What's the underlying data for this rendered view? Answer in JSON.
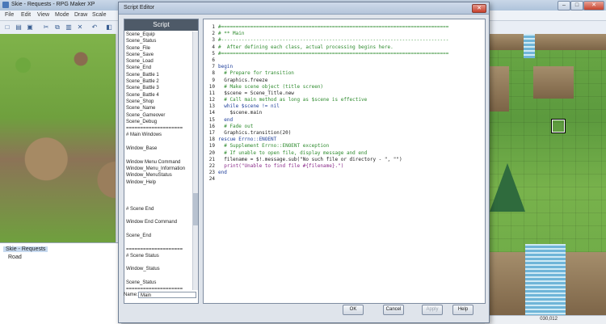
{
  "app": {
    "title": "Skie - Requests - RPG Maker XP",
    "window_buttons": [
      "–",
      "□",
      "✕"
    ]
  },
  "menu": [
    "File",
    "Edit",
    "View",
    "Mode",
    "Draw",
    "Scale"
  ],
  "map_tree": {
    "root": "Skie - Requests",
    "child": "Road"
  },
  "status": {
    "coords": "030,012"
  },
  "dialog": {
    "title": "Script Editor",
    "close": "✕",
    "list_header": "Script",
    "name_label": "Name:",
    "name_value": "Main",
    "buttons": {
      "ok": "OK",
      "cancel": "Cancel",
      "apply": "Apply",
      "help": "Help"
    }
  },
  "script_list": [
    "Scene_Equip",
    "Scene_Status",
    "Scene_File",
    "Scene_Save",
    "Scene_Load",
    "Scene_End",
    "Scene_Battle 1",
    "Scene_Battle 2",
    "Scene_Battle 3",
    "Scene_Battle 4",
    "Scene_Shop",
    "Scene_Name",
    "Scene_Gameover",
    "Scene_Debug",
    "====================",
    "# Main Windows",
    "",
    "Window_Base",
    "",
    "Window Menu Command",
    "Window_Menu_Information",
    "Window_MenuStatus",
    "Window_Help",
    "",
    "",
    "",
    "# Scene End",
    "",
    "Window End Command",
    "",
    "Scene_End",
    "",
    "====================",
    "# Scene Status",
    "",
    "Window_Status",
    "",
    "Scene_Status",
    "====================",
    "# Scene Menu",
    "",
    "Scene_Menu",
    "AMS",
    "Main"
  ],
  "selected_script": "Main",
  "code_lines": [
    {
      "n": "1",
      "text": "#==============================================================================",
      "style": "sep"
    },
    {
      "n": "2",
      "text": "# ** Main",
      "style": "comment"
    },
    {
      "n": "3",
      "text": "#------------------------------------------------------------------------------",
      "style": "sep"
    },
    {
      "n": "4",
      "text": "#  After defining each class, actual processing begins here.",
      "style": "comment"
    },
    {
      "n": "5",
      "text": "#==============================================================================",
      "style": "sep"
    },
    {
      "n": "6",
      "text": "",
      "style": "code"
    },
    {
      "n": "7",
      "text": "begin",
      "style": "keyword"
    },
    {
      "n": "8",
      "text": "  # Prepare for transition",
      "style": "comment"
    },
    {
      "n": "9",
      "text": "  Graphics.freeze",
      "style": "code"
    },
    {
      "n": "10",
      "text": "  # Make scene object (title screen)",
      "style": "comment"
    },
    {
      "n": "11",
      "text": "  $scene = Scene_Title.new",
      "style": "code"
    },
    {
      "n": "12",
      "text": "  # Call main method as long as $scene is effective",
      "style": "comment"
    },
    {
      "n": "13",
      "text": "  while $scene != nil",
      "style": "keyword"
    },
    {
      "n": "14",
      "text": "    $scene.main",
      "style": "code"
    },
    {
      "n": "15",
      "text": "  end",
      "style": "keyword"
    },
    {
      "n": "16",
      "text": "  # Fade out",
      "style": "comment"
    },
    {
      "n": "17",
      "text": "  Graphics.transition(20)",
      "style": "code"
    },
    {
      "n": "18",
      "text": "rescue Errno::ENOENT",
      "style": "keyword"
    },
    {
      "n": "19",
      "text": "  # Supplement Errno::ENOENT exception",
      "style": "comment"
    },
    {
      "n": "20",
      "text": "  # If unable to open file, display message and end",
      "style": "comment"
    },
    {
      "n": "21",
      "text": "  filename = $!.message.sub(\"No such file or directory - \", \"\")",
      "style": "code"
    },
    {
      "n": "22",
      "text": "  print(\"Unable to find file #{filename}.\")",
      "style": "string"
    },
    {
      "n": "23",
      "text": "end",
      "style": "keyword"
    },
    {
      "n": "24",
      "text": "",
      "style": "code"
    }
  ]
}
